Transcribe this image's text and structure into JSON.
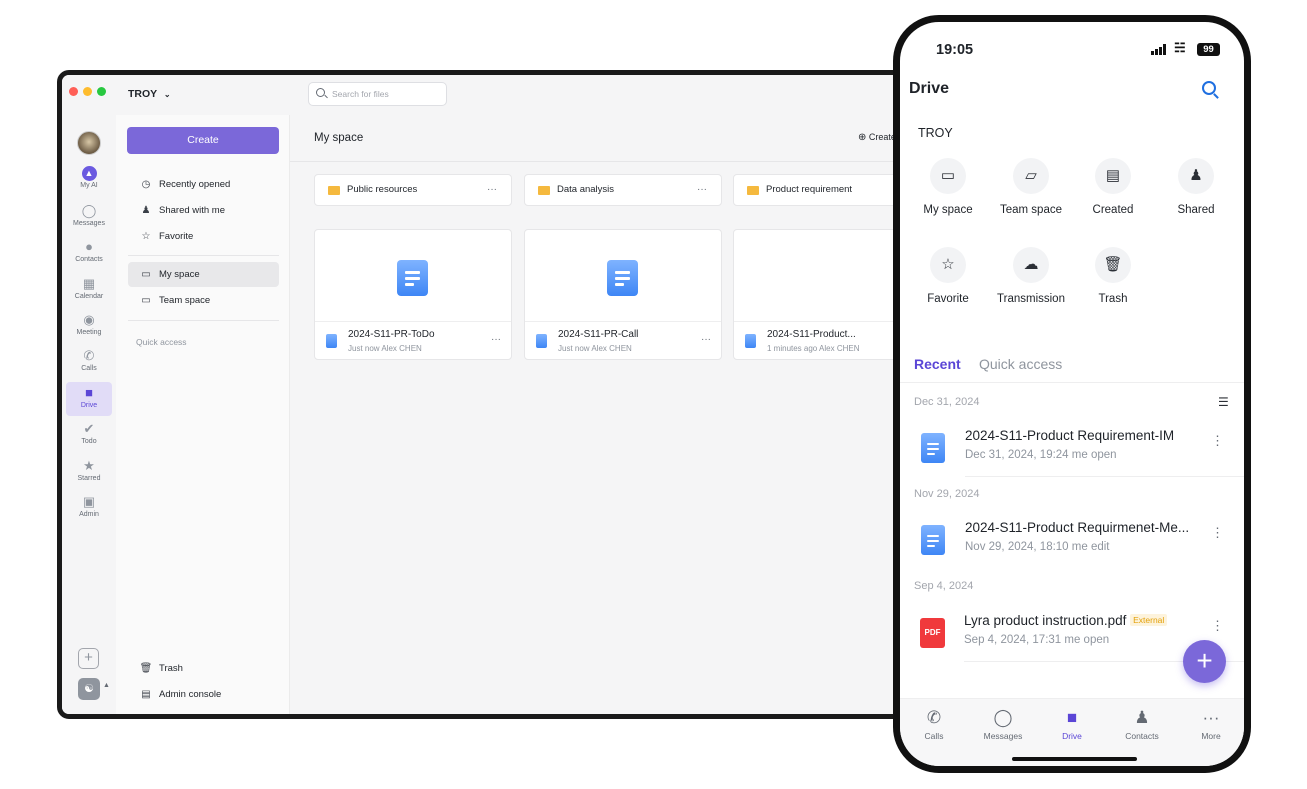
{
  "desktop": {
    "workspace": "TROY",
    "search_placeholder": "Search for files",
    "rail": [
      {
        "label": "My AI",
        "icon": "ai-icon"
      },
      {
        "label": "Messages",
        "icon": "messages-icon"
      },
      {
        "label": "Contacts",
        "icon": "contacts-icon"
      },
      {
        "label": "Calendar",
        "icon": "calendar-icon"
      },
      {
        "label": "Meeting",
        "icon": "meeting-icon"
      },
      {
        "label": "Calls",
        "icon": "calls-icon"
      },
      {
        "label": "Drive",
        "icon": "drive-icon"
      },
      {
        "label": "Todo",
        "icon": "todo-icon"
      },
      {
        "label": "Starred",
        "icon": "star-icon"
      },
      {
        "label": "Admin",
        "icon": "admin-icon"
      }
    ],
    "create_label": "Create",
    "nav": {
      "recently_opened": "Recently opened",
      "shared_with_me": "Shared with me",
      "favorite": "Favorite",
      "my_space": "My space",
      "team_space": "Team space",
      "quick_access": "Quick access",
      "trash": "Trash",
      "admin_console": "Admin console"
    },
    "main": {
      "title": "My space",
      "create_label": "Create",
      "folders": [
        "Public resources",
        "Data analysis",
        "Product requirement"
      ],
      "files": [
        {
          "name": "2024-S11-PR-ToDo",
          "meta": "Just now Alex CHEN"
        },
        {
          "name": "2024-S11-PR-Call",
          "meta": "Just now Alex CHEN"
        },
        {
          "name": "2024-S11-Product...",
          "meta": "1 minutes ago Alex CHEN"
        }
      ]
    }
  },
  "phone": {
    "time": "19:05",
    "battery": "99",
    "title": "Drive",
    "workspace": "TROY",
    "quick": [
      {
        "label": "My space",
        "icon": "my-space-icon"
      },
      {
        "label": "Team space",
        "icon": "team-space-icon"
      },
      {
        "label": "Created",
        "icon": "created-icon"
      },
      {
        "label": "Shared",
        "icon": "shared-icon"
      },
      {
        "label": "Favorite",
        "icon": "favorite-icon"
      },
      {
        "label": "Transmission",
        "icon": "transmission-icon"
      },
      {
        "label": "Trash",
        "icon": "trash-icon"
      }
    ],
    "tabs": {
      "recent": "Recent",
      "quick_access": "Quick access"
    },
    "groups": [
      {
        "date": "Dec 31, 2024",
        "title": "2024-S11-Product Requirement-IM",
        "meta": "Dec 31, 2024, 19:24 me open"
      },
      {
        "date": "Nov 29, 2024",
        "title": "2024-S11-Product Requirmenet-Me...",
        "meta": "Nov 29, 2024, 18:10 me edit"
      },
      {
        "date": "Sep 4, 2024",
        "title": "Lyra product instruction.pdf",
        "badge": "External",
        "meta": "Sep 4, 2024, 17:31 me open"
      }
    ],
    "pdf_label": "PDF",
    "bottom_tabs": [
      "Calls",
      "Messages",
      "Drive",
      "Contacts",
      "More"
    ],
    "accent": "#5b46d6"
  }
}
